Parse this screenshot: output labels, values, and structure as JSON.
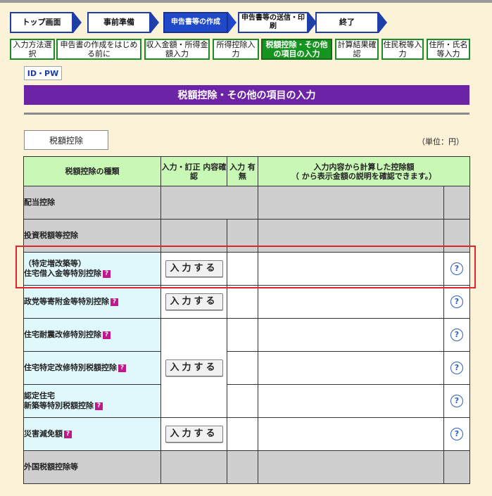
{
  "steps_main": [
    {
      "label": "トップ画面",
      "active": false
    },
    {
      "label": "事前準備",
      "active": false
    },
    {
      "label": "申告書等の作成",
      "active": true
    },
    {
      "label": "申告書等の送信・印刷",
      "active": false
    },
    {
      "label": "終了",
      "active": false
    }
  ],
  "steps_sub": [
    {
      "label": "入力方法選択",
      "active": false
    },
    {
      "label": "申告書の作成をはじめる前に",
      "active": false
    },
    {
      "label": "収入金額・所得金額入力",
      "active": false
    },
    {
      "label": "所得控除入力",
      "active": false
    },
    {
      "label": "税額控除・その他の項目の入力",
      "active": true
    },
    {
      "label": "計算結果確認",
      "active": false
    },
    {
      "label": "住民税等入力",
      "active": false
    },
    {
      "label": "住所・氏名等入力",
      "active": false
    }
  ],
  "idpw": "ID・PW",
  "page_title": "税額控除・その他の項目の入力",
  "section_label": "税額控除",
  "unit_label": "（単位：円）",
  "table": {
    "headers": {
      "type": "税額控除の種類",
      "confirm": "入力・訂正 内容確認",
      "input": "入力 有無",
      "amount": "入力内容から計算した控除額",
      "amount_note": "（  から表示金額の説明を確認できます。）"
    },
    "rows": [
      {
        "label": "配当控除"
      },
      {
        "label": "投資税額等控除"
      },
      {
        "label_line1": "（特定増改築等）",
        "label_line2": "住宅借入金等特別控除"
      },
      {
        "label": "政党等寄附金等特別控除"
      },
      {
        "label": "住宅耐震改修特別控除"
      },
      {
        "label": "住宅特定改修特別税額控除"
      },
      {
        "label_line1": "認定住宅",
        "label_line2": "新築等特別税額控除"
      },
      {
        "label": "災害減免額"
      },
      {
        "label": "外国税額控除等"
      }
    ],
    "button_label": "入力する",
    "help_glyph": "?"
  },
  "colors": {
    "bg": "#fbf2d8",
    "title_bar": "#6d23a6",
    "header_green": "#c9f7b6",
    "row_cyan": "#dff8fb",
    "highlight": "#e0262c"
  }
}
